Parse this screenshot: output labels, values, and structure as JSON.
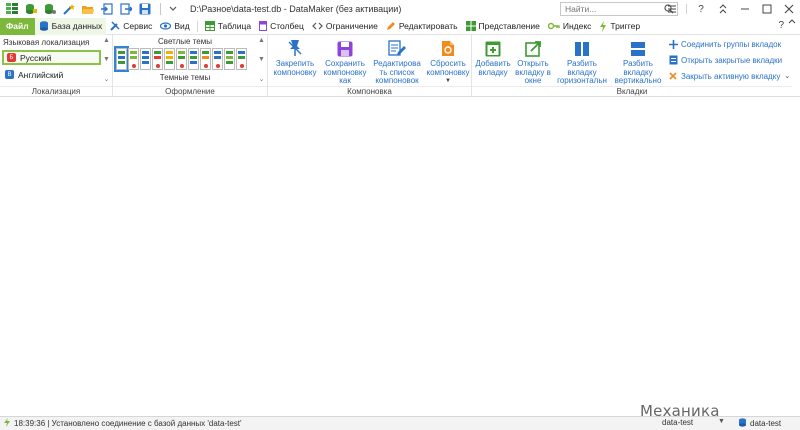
{
  "window": {
    "title": "D:\\Разное\\data-test.db - DataMaker (без активации)",
    "search_placeholder": "Найти..."
  },
  "menu": {
    "file": "Файл",
    "tabs": [
      {
        "label": "База данных",
        "icon": "database-icon"
      },
      {
        "label": "Сервис",
        "icon": "tools-icon"
      },
      {
        "label": "Вид",
        "icon": "eye-icon"
      },
      {
        "label": "Таблица",
        "icon": "table-icon"
      },
      {
        "label": "Столбец",
        "icon": "column-icon"
      },
      {
        "label": "Ограничение",
        "icon": "constraint-icon"
      },
      {
        "label": "Редактировать",
        "icon": "pencil-icon"
      },
      {
        "label": "Представление",
        "icon": "view-icon"
      },
      {
        "label": "Индекс",
        "icon": "key-icon"
      },
      {
        "label": "Триггер",
        "icon": "bolt-icon"
      }
    ],
    "help": "?"
  },
  "ribbon": {
    "locale": {
      "title": "Языковая локализация",
      "languages": [
        "Русский",
        "Английский"
      ],
      "group_label": "Локализация"
    },
    "themes": {
      "light_title": "Светлые темы",
      "dark_title": "Темные темы",
      "group_label": "Оформление"
    },
    "layout": {
      "buttons": [
        "Закрепить компоновку",
        "Сохранить компоновку как",
        "Редактирова ть список компоновок",
        "Сбросить компоновку"
      ],
      "group_label": "Компоновка"
    },
    "tabs": {
      "buttons": [
        "Добавить вкладку",
        "Открыть вкладку в окне",
        "Разбить вкладку горизонтальн",
        "Разбить вкладку вертикально"
      ],
      "small_buttons": [
        "Соединить группы вкладок",
        "Открыть закрытые вкладки",
        "Закрыть активную вкладку"
      ],
      "group_label": "Вкладки"
    }
  },
  "status": {
    "message": "18:39:36 | Установлено соединение с базой данных 'data-test'",
    "database": "data-test",
    "connection": "data-test"
  },
  "watermark": "Механика вселенной",
  "colors": {
    "accent_green": "#7cb83b",
    "accent_blue": "#2a72c8",
    "purple": "#8e44d9",
    "orange": "#f08c1e"
  }
}
